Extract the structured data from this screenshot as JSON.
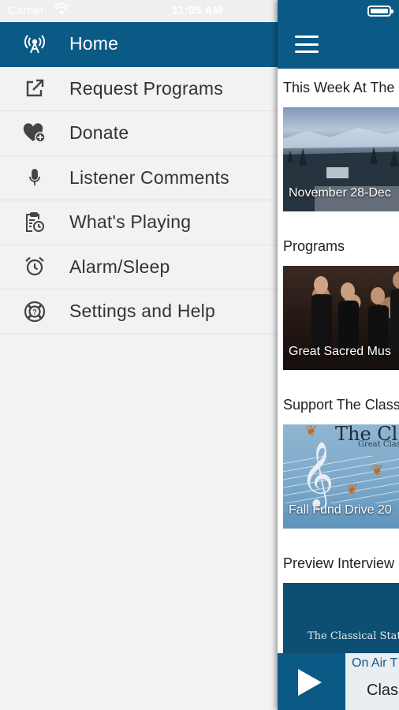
{
  "status_bar": {
    "carrier": "Carrier",
    "time": "11:05 AM"
  },
  "menu": {
    "items": [
      {
        "label": "Home",
        "icon": "radio-tower-icon",
        "active": true
      },
      {
        "label": "Request Programs",
        "icon": "external-link-icon",
        "active": false
      },
      {
        "label": "Donate",
        "icon": "heart-plus-icon",
        "active": false
      },
      {
        "label": "Listener Comments",
        "icon": "microphone-icon",
        "active": false
      },
      {
        "label": "What's Playing",
        "icon": "clipboard-clock-icon",
        "active": false
      },
      {
        "label": "Alarm/Sleep",
        "icon": "alarm-clock-icon",
        "active": false
      },
      {
        "label": "Settings and Help",
        "icon": "help-circle-icon",
        "active": false
      }
    ]
  },
  "main": {
    "sections": [
      {
        "title": "This Week At The",
        "card_caption": "November 28-Dec"
      },
      {
        "title": "Programs",
        "card_caption": "Great Sacred Mus"
      },
      {
        "title": "Support The Class",
        "card_caption": "Fall Fund Drive 20",
        "card_image_title": "The Cl",
        "card_image_subtitle": "Great Clas"
      },
      {
        "title": "Preview Interview",
        "card_image_text": "The Classical Statio"
      }
    ]
  },
  "player": {
    "on_air_label": "On Air T",
    "now_title": "Clas"
  },
  "colors": {
    "primary": "#0b5a86",
    "drawer_bg": "#f2f2f2",
    "text": "#333333"
  }
}
